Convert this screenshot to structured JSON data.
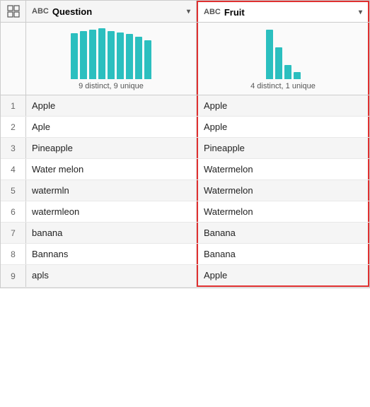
{
  "columns": {
    "rowNum": "",
    "question": {
      "icon": "ABC",
      "label": "Question",
      "chartLabel": "9 distinct, 9 unique",
      "bars": [
        65,
        68,
        70,
        72,
        68,
        66,
        64,
        60,
        55
      ]
    },
    "fruit": {
      "icon": "ABC",
      "label": "Fruit",
      "chartLabel": "4 distinct, 1 unique",
      "bars": [
        70,
        45,
        20,
        10
      ]
    }
  },
  "rows": [
    {
      "num": "1",
      "question": "Apple",
      "fruit": "Apple"
    },
    {
      "num": "2",
      "question": "Aple",
      "fruit": "Apple"
    },
    {
      "num": "3",
      "question": "Pineapple",
      "fruit": "Pineapple"
    },
    {
      "num": "4",
      "question": "Water melon",
      "fruit": "Watermelon"
    },
    {
      "num": "5",
      "question": "watermln",
      "fruit": "Watermelon"
    },
    {
      "num": "6",
      "question": "watermleon",
      "fruit": "Watermelon"
    },
    {
      "num": "7",
      "question": "banana",
      "fruit": "Banana"
    },
    {
      "num": "8",
      "question": "Bannans",
      "fruit": "Banana"
    },
    {
      "num": "9",
      "question": "apls",
      "fruit": "Apple"
    }
  ],
  "gridIcon": "⊞"
}
